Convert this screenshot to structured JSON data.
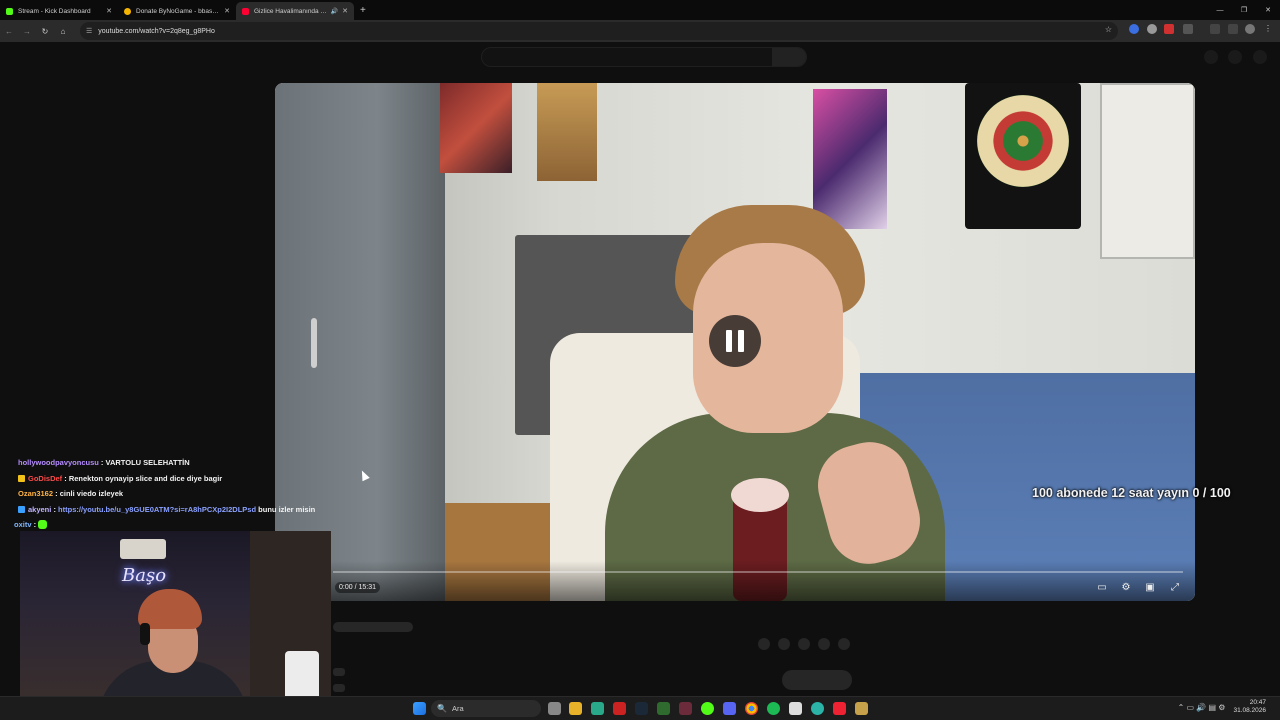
{
  "browser": {
    "tabs": [
      {
        "title": "Stream - Kick Dashboard",
        "favicon_color": "#53fc18"
      },
      {
        "title": "Donate ByNoGame - bbasho D...",
        "favicon_color": "#f5b400"
      },
      {
        "title": "Gizlice Havalimanında Yaşa...",
        "favicon_color": "#ff0033"
      }
    ],
    "new_tab": "+",
    "url": "youtube.com/watch?v=2q8eg_g8PHo"
  },
  "player": {
    "time": "0:00 / 15:31"
  },
  "overlay": {
    "goal_text": "100 abonede 12 saat yayın 0 / 100"
  },
  "chat": [
    {
      "user": "hollywoodpavyoncusu",
      "user_color": "#b58cff",
      "badge": "",
      "message": "VARTOLU SELEHATTİN",
      "link": ""
    },
    {
      "user": "GoDisDef",
      "user_color": "#ff4a4a",
      "badge": "#f2c21a",
      "message": "Renekton oynayip slice and dice diye bagir",
      "link": ""
    },
    {
      "user": "Ozan3162",
      "user_color": "#ffb347",
      "badge": "",
      "message": "cinli viedo izleyek",
      "link": ""
    },
    {
      "user": "akyeni",
      "user_color": "#c0b4ff",
      "badge": "#3aa0ff",
      "message": "bunu izler misin",
      "link": "https://youtu.be/u_y8GUE0ATM?si=rA8hPCXp2I2DLPsd"
    },
    {
      "user": "oxitv",
      "user_color": "#7fb7ff",
      "badge": "",
      "message": "",
      "link": ""
    }
  ],
  "webcam": {
    "neon_sign": "Başo"
  },
  "taskbar": {
    "search_placeholder": "Ara",
    "time": "20:47",
    "date": "31.08.2026"
  }
}
